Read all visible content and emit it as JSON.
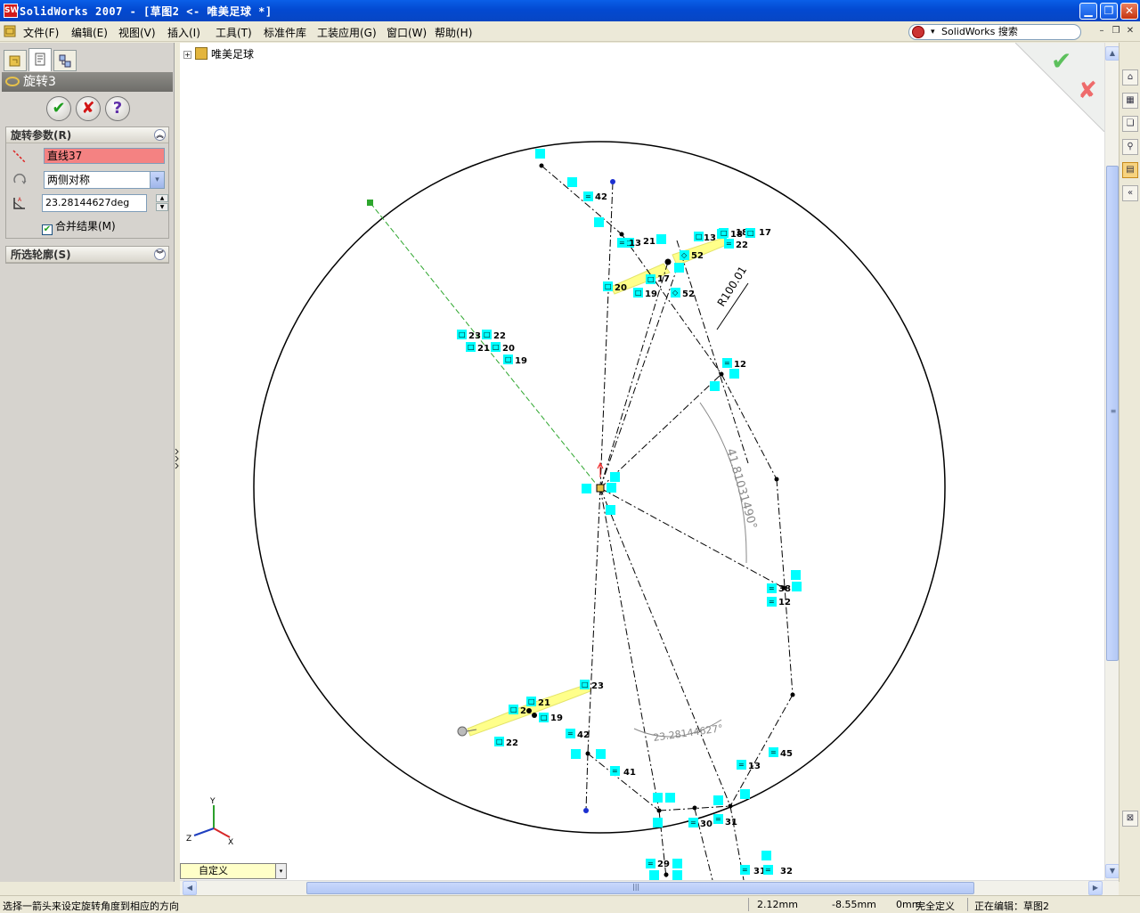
{
  "window": {
    "title": "SolidWorks 2007 - [草图2 <- 唯美足球 *]",
    "min_glyph": "▁",
    "restore_glyph": "❐",
    "close_glyph": "✕",
    "logo_text": "SW"
  },
  "menu": {
    "items": [
      "文件(F)",
      "编辑(E)",
      "视图(V)",
      "插入(I)",
      "工具(T)",
      "标准件库",
      "工装应用(G)",
      "窗口(W)",
      "帮助(H)"
    ],
    "search_label": "SolidWorks 搜索",
    "search_arrow": "▾",
    "doc_min": "–",
    "doc_restore": "❐",
    "doc_close": "✕"
  },
  "panel": {
    "feature_title": "旋转3",
    "ok_glyph": "✔",
    "cancel_glyph": "✘",
    "help_glyph": "?",
    "params_group": {
      "title": "旋转参数(R)",
      "collapse_glyph": "︽",
      "axis_value": "直线37",
      "type_value": "两侧对称",
      "type_drop": "▾",
      "angle_value": "23.28144627deg",
      "spin_up": "▲",
      "spin_down": "▼",
      "merge_checked_glyph": "✔",
      "merge_label": "合并结果(M)"
    },
    "contours_group": {
      "title": "所选轮廓(S)",
      "expand_glyph": "︾"
    }
  },
  "canvas": {
    "tree_root": "唯美足球",
    "tree_expander": "+",
    "confirm_ok_glyph": "✔",
    "confirm_cancel_glyph": "✘",
    "view_orientation": "自定义",
    "view_drop": "▾",
    "dimension_radius": "R100.01",
    "dimension_angle_large": "41.81031490°",
    "dimension_angle_small": "23.28144627°",
    "triad": {
      "x": "X",
      "y": "Y",
      "z": "Z"
    }
  },
  "sketch_labels": [
    {
      "text": "42"
    },
    {
      "text": "21"
    },
    {
      "text": "13"
    },
    {
      "text": "18"
    },
    {
      "text": "17"
    },
    {
      "text": "22"
    },
    {
      "text": "13"
    },
    {
      "text": "52"
    },
    {
      "text": "20"
    },
    {
      "text": "17"
    },
    {
      "text": "19"
    },
    {
      "text": "52"
    },
    {
      "text": "23"
    },
    {
      "text": "22"
    },
    {
      "text": "21"
    },
    {
      "text": "20"
    },
    {
      "text": "19"
    },
    {
      "text": "12"
    },
    {
      "text": "38"
    },
    {
      "text": "12"
    },
    {
      "text": "23"
    },
    {
      "text": "21"
    },
    {
      "text": "2"
    },
    {
      "text": "19"
    },
    {
      "text": "22"
    },
    {
      "text": "42"
    },
    {
      "text": "41"
    },
    {
      "text": "45"
    },
    {
      "text": "13"
    },
    {
      "text": "30"
    },
    {
      "text": "31"
    },
    {
      "text": "29"
    },
    {
      "text": "31"
    },
    {
      "text": "32"
    },
    {
      "text": "18"
    }
  ],
  "scrollbars": {
    "up": "▲",
    "down": "▼",
    "left": "◀",
    "right": "▶",
    "grip_v": "≡",
    "grip_h": "|||"
  },
  "taskpane": {
    "buttons": [
      "⌂",
      "▦",
      "❏",
      "⚲",
      "▤",
      "«"
    ],
    "bottom": "⊠"
  },
  "status": {
    "message": "选择一箭头来设定旋转角度到相应的方向",
    "x": "2.12mm",
    "y": "-8.55mm",
    "z": "0mm",
    "state": "完全定义",
    "editing": "正在编辑：草图2"
  },
  "colors": {
    "titlebar": "#0349d1",
    "relation_badge": "#00ffff",
    "axis_field": "#f48282",
    "highlight": "#ffff88",
    "construction": "#2da62d"
  }
}
